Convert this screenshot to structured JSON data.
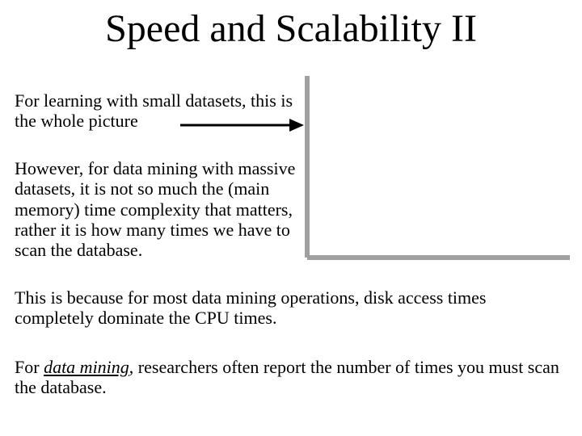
{
  "title": "Speed and Scalability II",
  "para1": "For learning with small datasets, this is the whole picture",
  "para2": "However, for data mining with massive datasets, it is not so much the (main memory) time complexity that matters, rather it is how many times we have to scan the database.",
  "para3": "This is because for most data mining operations, disk access times completely dominate the CPU times.",
  "para4_prefix": "For ",
  "para4_em": "data mining",
  "para4_suffix": ", researchers often report the number of times you must scan the database."
}
